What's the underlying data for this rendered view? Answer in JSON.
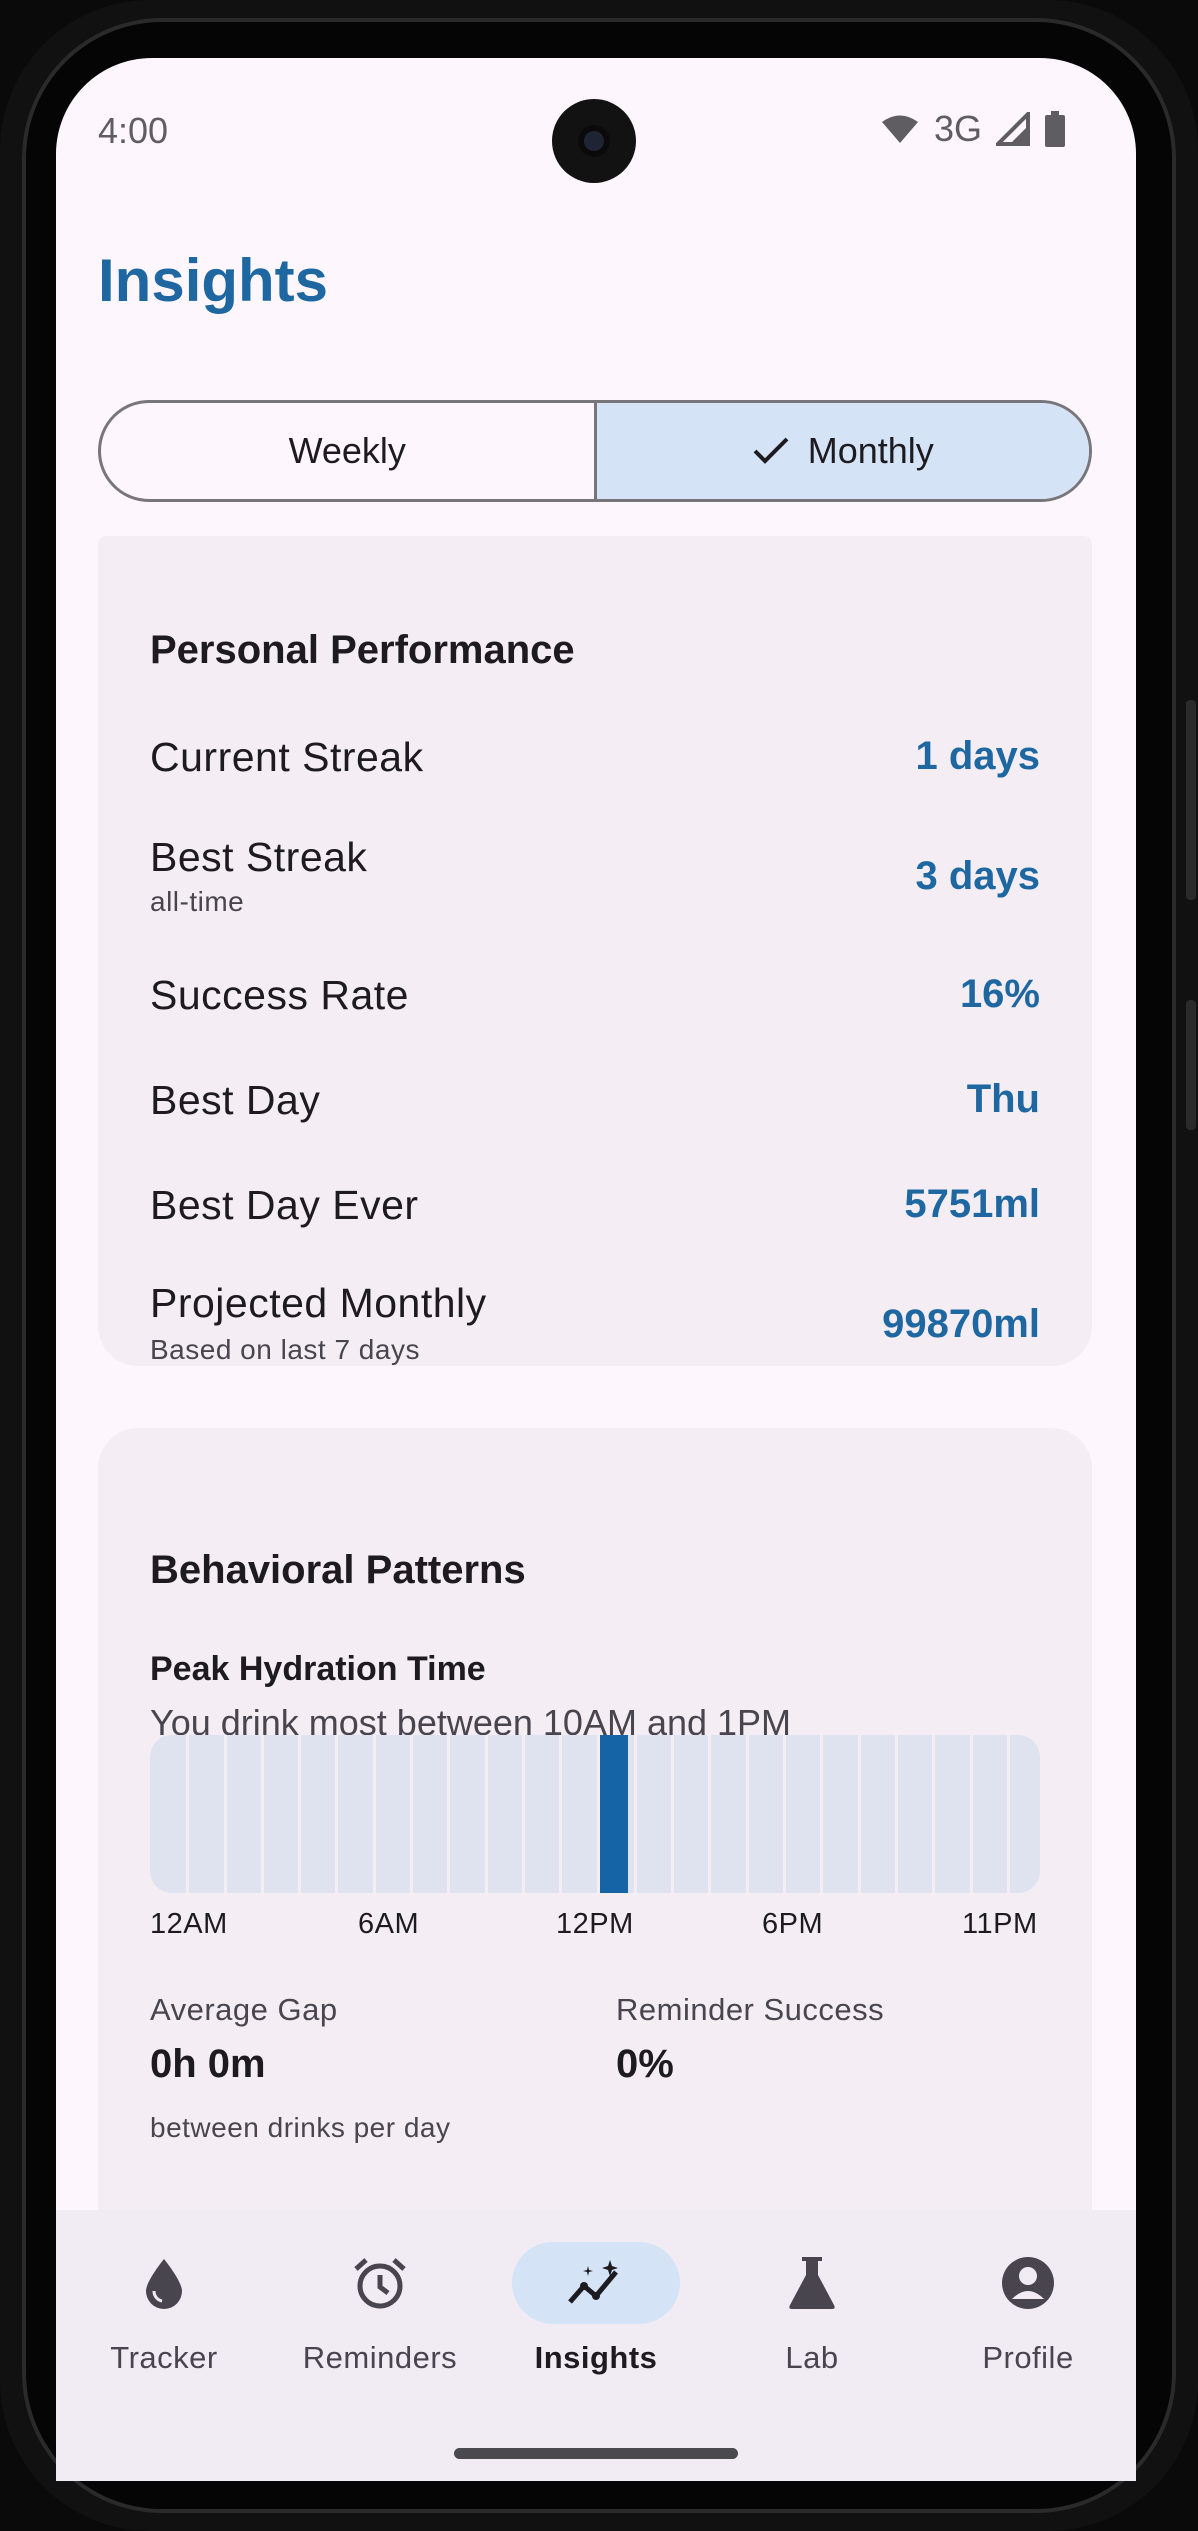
{
  "status_bar": {
    "time": "4:00",
    "network": "3G",
    "icons": [
      "wifi-icon",
      "signal-icon",
      "battery-icon"
    ]
  },
  "page": {
    "title": "Insights"
  },
  "period_toggle": {
    "options": [
      {
        "label": "Weekly",
        "selected": false
      },
      {
        "label": "Monthly",
        "selected": true
      }
    ]
  },
  "performance": {
    "title": "Personal Performance",
    "rows": [
      {
        "label": "Current Streak",
        "sub": "",
        "value": "1 days"
      },
      {
        "label": "Best Streak",
        "sub": "all-time",
        "value": "3 days"
      },
      {
        "label": "Success Rate",
        "sub": "",
        "value": "16%"
      },
      {
        "label": "Best Day",
        "sub": "",
        "value": "Thu"
      },
      {
        "label": "Best Day Ever",
        "sub": "",
        "value": "5751ml"
      },
      {
        "label": "Projected Monthly",
        "sub": "Based on last 7 days",
        "value": "99870ml"
      }
    ]
  },
  "behavior": {
    "title": "Behavioral Patterns",
    "peak_title": "Peak Hydration Time",
    "peak_text": "You drink most between 10AM and 1PM",
    "hours_count": 24,
    "peak_hour_index": 12,
    "ticks": [
      "12AM",
      "6AM",
      "12PM",
      "6PM",
      "11PM"
    ],
    "average_gap": {
      "label": "Average Gap",
      "value": "0h 0m",
      "sub": "between drinks per day"
    },
    "reminder_success": {
      "label": "Reminder Success",
      "value": "0%"
    }
  },
  "nav": {
    "items": [
      {
        "label": "Tracker",
        "icon": "water-drop-icon",
        "active": false
      },
      {
        "label": "Reminders",
        "icon": "alarm-clock-icon",
        "active": false
      },
      {
        "label": "Insights",
        "icon": "insights-chart-icon",
        "active": true
      },
      {
        "label": "Lab",
        "icon": "flask-icon",
        "active": false
      },
      {
        "label": "Profile",
        "icon": "profile-icon",
        "active": false
      }
    ]
  },
  "colors": {
    "accent": "#1f67a0",
    "selected_bg": "#d5e3f6",
    "card_bg": "#f4eef4",
    "bar_peak": "#1565a6"
  }
}
